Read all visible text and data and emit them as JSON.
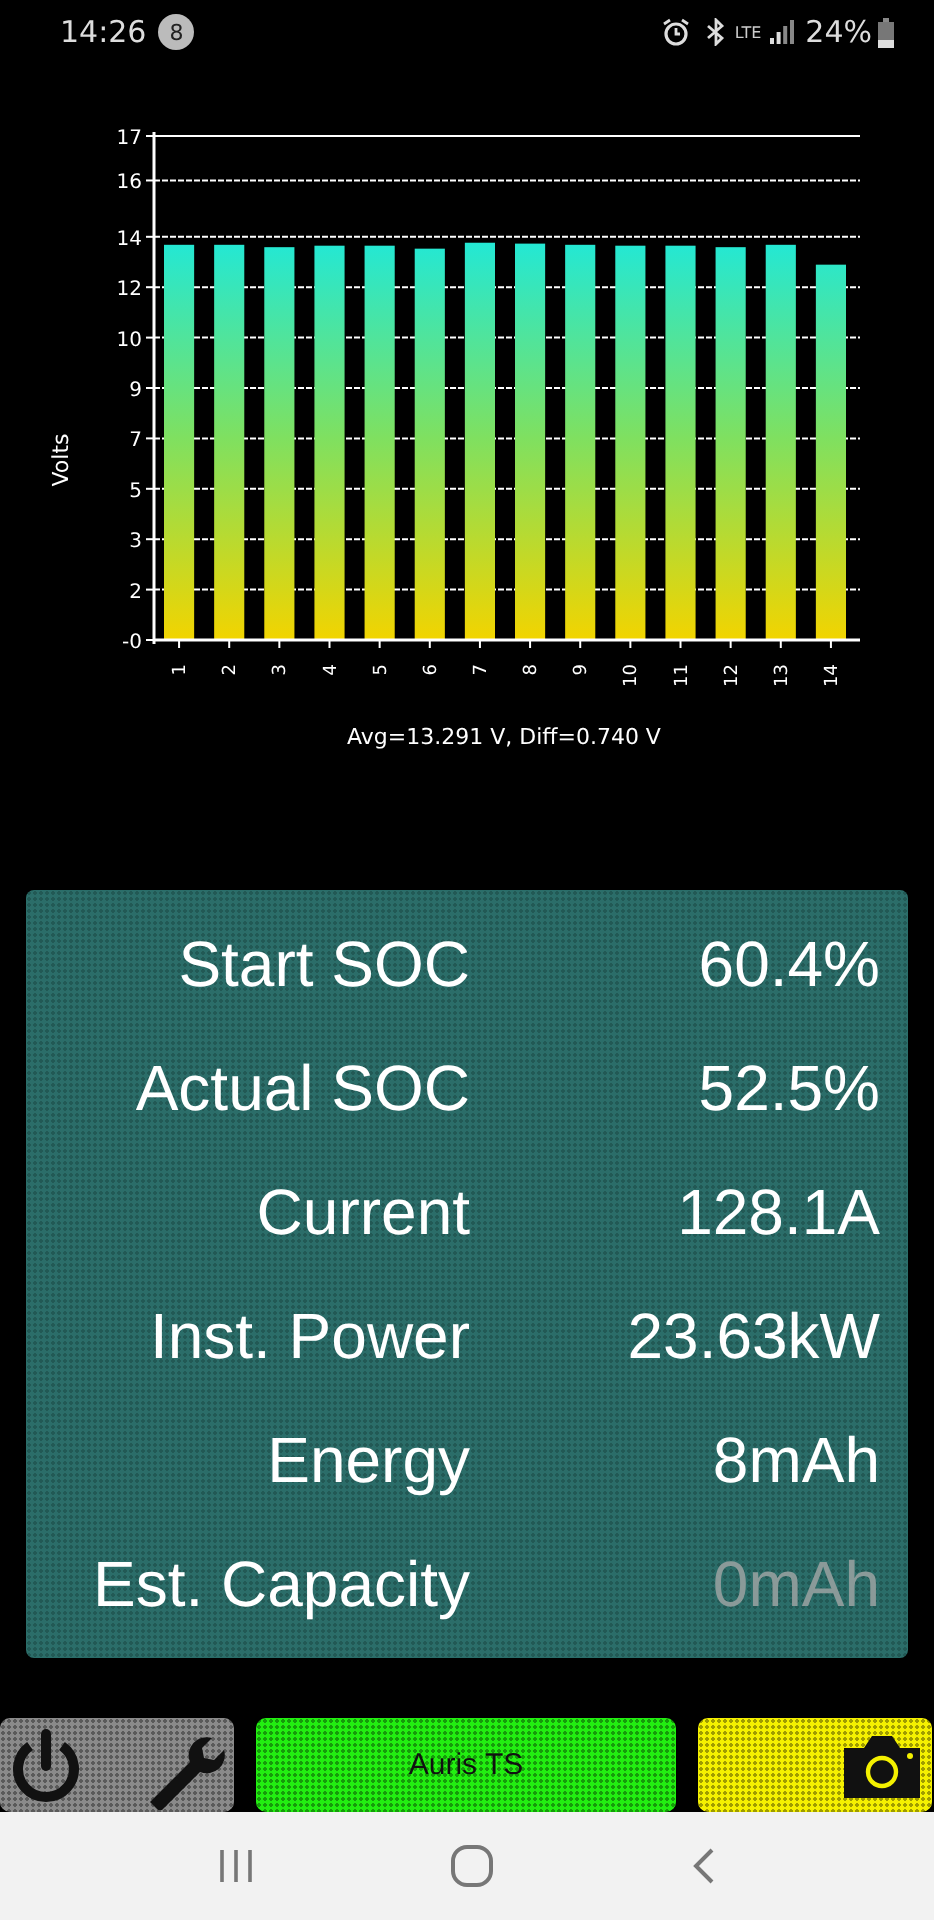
{
  "status_bar": {
    "time": "14:26",
    "notification_count": "8",
    "network": "LTE",
    "battery": "24%"
  },
  "chart": {
    "chart_data": {
      "type": "bar",
      "ylabel": "Volts",
      "xlabel": "Avg=13.291 V, Diff=0.740 V",
      "categories": [
        "1",
        "2",
        "3",
        "4",
        "5",
        "6",
        "7",
        "8",
        "9",
        "10",
        "11",
        "12",
        "13",
        "14"
      ],
      "grid": true,
      "series": [
        {
          "color": "#20e8d8",
          "values": [
            13.33,
            13.33,
            13.25,
            13.3,
            13.3,
            13.2,
            13.4,
            13.37,
            13.33,
            13.3,
            13.3,
            13.25,
            13.33,
            12.66
          ]
        }
      ],
      "ylim": [
        0,
        17
      ],
      "yticks": [
        {
          "value": 0,
          "label": "-0"
        },
        {
          "value": 1.7,
          "label": "2"
        },
        {
          "value": 3.4,
          "label": "3"
        },
        {
          "value": 5.1,
          "label": "5"
        },
        {
          "value": 6.8,
          "label": "7"
        },
        {
          "value": 8.5,
          "label": "9"
        },
        {
          "value": 10.2,
          "label": "10"
        },
        {
          "value": 11.9,
          "label": "12"
        },
        {
          "value": 13.6,
          "label": "14"
        },
        {
          "value": 15.5,
          "label": "16"
        },
        {
          "value": 17,
          "label": "17"
        }
      ]
    }
  },
  "stats": [
    {
      "label": "Start SOC",
      "value": "60.4%",
      "dimmed": false
    },
    {
      "label": "Actual SOC",
      "value": "52.5%",
      "dimmed": false
    },
    {
      "label": "Current",
      "value": "128.1A",
      "dimmed": false
    },
    {
      "label": "Inst. Power",
      "value": "23.63kW",
      "dimmed": false
    },
    {
      "label": "Energy",
      "value": "8mAh",
      "dimmed": false
    },
    {
      "label": "Est. Capacity",
      "value": "0mAh",
      "dimmed": true
    }
  ],
  "toolbar": {
    "vehicle": "Auris TS"
  }
}
